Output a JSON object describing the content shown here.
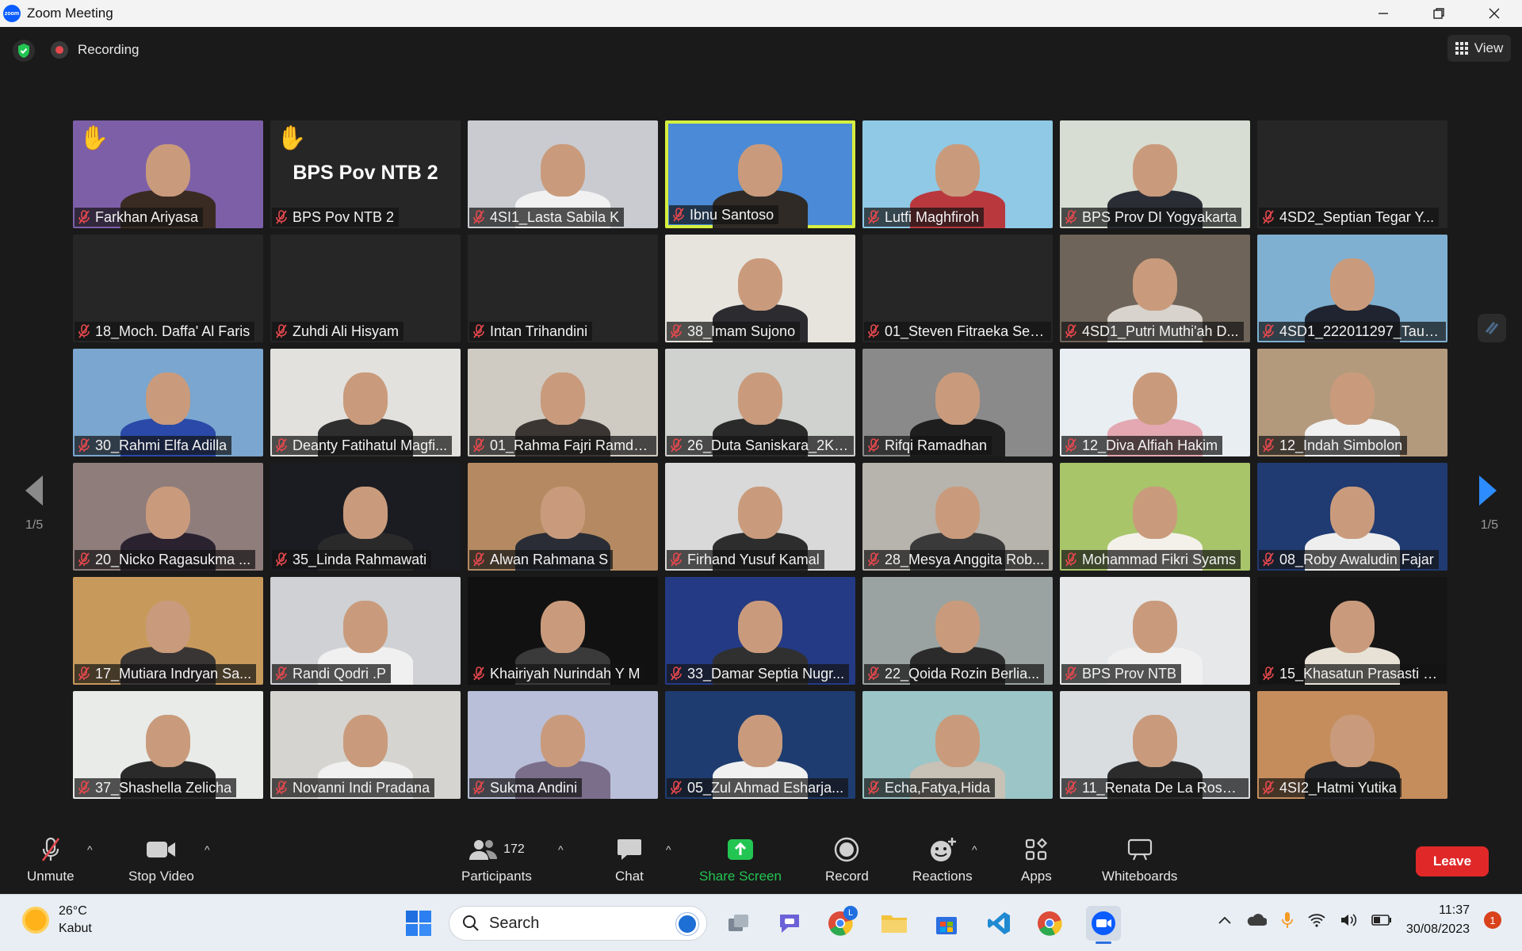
{
  "window": {
    "title": "Zoom Meeting",
    "logo_text": "zoom"
  },
  "topbar": {
    "recording_label": "Recording",
    "view_label": "View"
  },
  "pager": {
    "left": "1/5",
    "right": "1/5"
  },
  "participants": [
    {
      "name": "Farkhan Ariyasa",
      "bg": "#7d5fa8",
      "hand": true,
      "person": "#3a2b22"
    },
    {
      "name": "BPS Pov NTB 2",
      "bg": "#262626",
      "hand": true,
      "caption": "BPS Pov NTB 2"
    },
    {
      "name": "4SI1_Lasta Sabila K",
      "bg": "#c9cbd0",
      "person": "#f1f1f1"
    },
    {
      "name": "Ibnu Santoso",
      "bg": "#4a8ad6",
      "active": true,
      "person": "#2f2a25"
    },
    {
      "name": "Lutfi Maghfiroh",
      "bg": "#8fc9e6",
      "person": "#b8383e"
    },
    {
      "name": "BPS Prov DI Yogyakarta",
      "bg": "#d7ddd2",
      "person": "#2a2d35"
    },
    {
      "name": "4SD2_Septian Tegar Y...",
      "bg": "#262626"
    },
    {
      "name": "18_Moch. Daffa' Al Faris",
      "bg": "#262626"
    },
    {
      "name": "Zuhdi Ali Hisyam",
      "bg": "#262626"
    },
    {
      "name": "Intan Trihandini",
      "bg": "#262626"
    },
    {
      "name": "38_Imam Sujono",
      "bg": "#e7e4de",
      "person": "#2b2b30"
    },
    {
      "name": "01_Steven Fitraeka Seti...",
      "bg": "#262626"
    },
    {
      "name": "4SD1_Putri Muthi'ah D...",
      "bg": "#6f6459",
      "person": "#d8d3cc"
    },
    {
      "name": "4SD1_222011297_Taufi...",
      "bg": "#7fb0d2",
      "person": "#1f2430"
    },
    {
      "name": "30_Rahmi Elfa Adilla",
      "bg": "#7aa6cf",
      "person": "#2a49a8"
    },
    {
      "name": "Deanty Fatihatul Magfi...",
      "bg": "#e3e1de",
      "person": "#2e2e2e"
    },
    {
      "name": "01_Rahma Fajri Ramdh...",
      "bg": "#cfcac2",
      "person": "#3b3633"
    },
    {
      "name": "26_Duta Saniskara_2KS2",
      "bg": "#cfd2cf",
      "person": "#2a2a2a"
    },
    {
      "name": "Rifqi Ramadhan",
      "bg": "#8a8a8a",
      "person": "#1e1e1e"
    },
    {
      "name": "12_Diva Alfiah Hakim",
      "bg": "#e9eef3",
      "person": "#e3a8b1"
    },
    {
      "name": "12_Indah Simbolon",
      "bg": "#b49a7d",
      "person": "#f0f0f0"
    },
    {
      "name": "20_Nicko Ragasukma ...",
      "bg": "#8f7d7c",
      "person": "#2b2230"
    },
    {
      "name": "35_Linda Rahmawati",
      "bg": "#1b1c22",
      "person": "#2a2a2a"
    },
    {
      "name": "Alwan Rahmana S",
      "bg": "#b58a62",
      "person": "#2a2d36"
    },
    {
      "name": "Firhand Yusuf Kamal",
      "bg": "#d9d9d9",
      "person": "#2d2d2d"
    },
    {
      "name": "28_Mesya Anggita Rob...",
      "bg": "#b7b3ad",
      "person": "#3a3a3a"
    },
    {
      "name": "Mohammad Fikri Syams",
      "bg": "#a8c56a",
      "person": "#f4f1ea"
    },
    {
      "name": "08_Roby Awaludin Fajar",
      "bg": "#203a72",
      "person": "#eeeeee"
    },
    {
      "name": "17_Mutiara Indryan Sa...",
      "bg": "#c79a5c",
      "person": "#3a3535"
    },
    {
      "name": "Randi Qodri .P",
      "bg": "#cfd1d4",
      "person": "#f0f0f0"
    },
    {
      "name": "Khairiyah Nurindah Y M",
      "bg": "#111111",
      "person": "#3a3a3a"
    },
    {
      "name": "33_Damar Septia Nugr...",
      "bg": "#243a84",
      "person": "#303030"
    },
    {
      "name": "22_Qoida Rozin Berlia...",
      "bg": "#9aa3a1",
      "person": "#2b2b2b"
    },
    {
      "name": "BPS Prov NTB",
      "bg": "#e6e8ea",
      "person": "#f0f0f0"
    },
    {
      "name": "15_Khasatun Prasasti S...",
      "bg": "#151515",
      "person": "#e8e2d6"
    },
    {
      "name": "37_Shashella Zelicha",
      "bg": "#e8ebe8",
      "person": "#2a2a2a"
    },
    {
      "name": "Novanni Indi Pradana",
      "bg": "#d6d4d0",
      "person": "#f0f0f0"
    },
    {
      "name": "Sukma Andini",
      "bg": "#b9bfd8",
      "person": "#7b6e8a"
    },
    {
      "name": "05_Zul Ahmad Esharja...",
      "bg": "#1e3c70",
      "person": "#f0f0f0"
    },
    {
      "name": "Echa,Fatya,Hida",
      "bg": "#9cc5c7",
      "person": "#c7c1b6"
    },
    {
      "name": "11_Renata De La Rosa ...",
      "bg": "#d9dde0",
      "person": "#2c2c2c"
    },
    {
      "name": "4SI2_Hatmi Yutika",
      "bg": "#c58d5c",
      "person": "#232427"
    }
  ],
  "toolbar": {
    "unmute": "Unmute",
    "stop_video": "Stop Video",
    "participants": "Participants",
    "participant_count": "172",
    "chat": "Chat",
    "share_screen": "Share Screen",
    "record": "Record",
    "reactions": "Reactions",
    "apps": "Apps",
    "whiteboards": "Whiteboards",
    "leave": "Leave"
  },
  "taskbar": {
    "temperature": "26°C",
    "weather": "Kabut",
    "search_placeholder": "Search",
    "time": "11:37",
    "date": "30/08/2023",
    "notifications": "1",
    "chrome_badge": "L"
  },
  "colors": {
    "active_speaker": "#d7ef3f",
    "share_green": "#23c552",
    "leave_red": "#e02828",
    "arrow_blue": "#2d8cff"
  }
}
